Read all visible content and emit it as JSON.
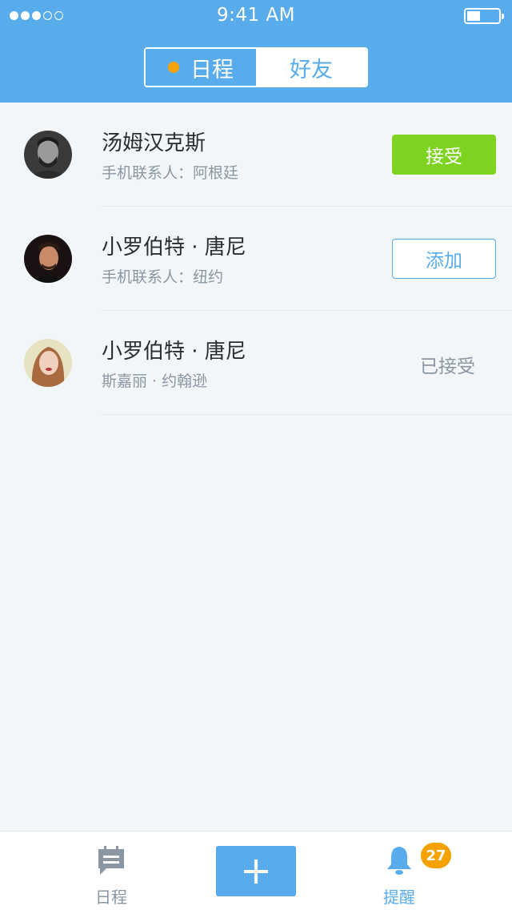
{
  "status_bar": {
    "time": "9:41 AM",
    "signal_dots_filled": 3,
    "signal_dots_total": 5,
    "battery_level": 0.35
  },
  "segment": {
    "tabs": [
      {
        "label": "日程"
      },
      {
        "label": "好友"
      }
    ]
  },
  "friends": [
    {
      "name": "汤姆汉克斯",
      "sub": "手机联系人：阿根廷",
      "action": "接受",
      "action_type": "accept"
    },
    {
      "name": "小罗伯特 · 唐尼",
      "sub": "手机联系人：纽约",
      "action": "添加",
      "action_type": "add"
    },
    {
      "name": "小罗伯特 · 唐尼",
      "sub": "斯嘉丽 · 约翰逊",
      "action": "已接受",
      "action_type": "accepted"
    }
  ],
  "tabbar": {
    "schedule_label": "日程",
    "add_icon": "plus-icon",
    "remind_label": "提醒",
    "remind_badge": "27"
  },
  "colors": {
    "primary": "#58acec",
    "accept": "#7ed321",
    "badge": "#f5a100"
  }
}
